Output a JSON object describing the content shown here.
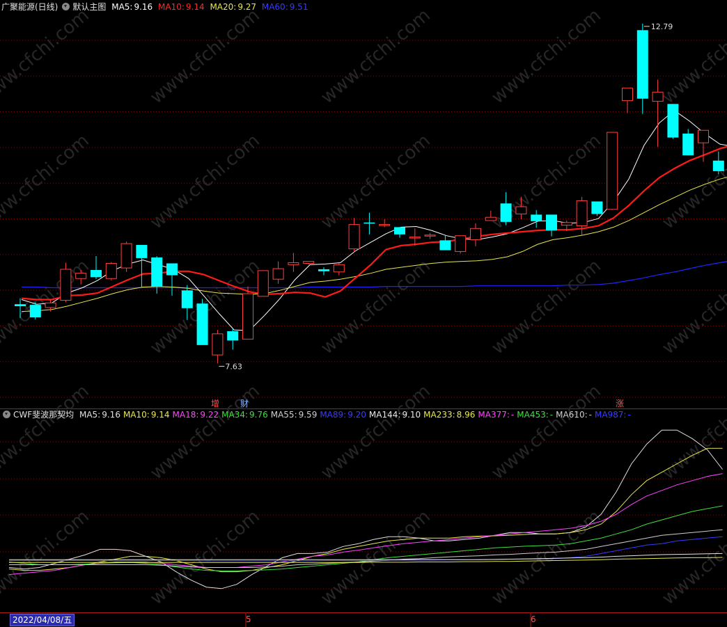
{
  "main_header": {
    "stock": "广聚能源(日线)",
    "indicator": "默认主图",
    "ma5_label": "MA5:",
    "ma5": "9.16",
    "ma10_label": "MA10:",
    "ma10": "9.14",
    "ma20_label": "MA20:",
    "ma20": "9.27",
    "ma60_label": "MA60:",
    "ma60": "9.51"
  },
  "sub_header": {
    "indicator": "CWF斐波那契均",
    "items": [
      {
        "label": "MA5:",
        "value": "9.16",
        "color": "#e0e0e0"
      },
      {
        "label": "MA10:",
        "value": "9.14",
        "color": "#e8e84a"
      },
      {
        "label": "MA18:",
        "value": "9.22",
        "color": "#ff44ff"
      },
      {
        "label": "MA34:",
        "value": "9.76",
        "color": "#3ee03e"
      },
      {
        "label": "MA55:",
        "value": "9.59",
        "color": "#cfcfcf"
      },
      {
        "label": "MA89:",
        "value": "9.20",
        "color": "#3a3aff"
      },
      {
        "label": "MA144:",
        "value": "9.10",
        "color": "#e8e8e8"
      },
      {
        "label": "MA233:",
        "value": "8.96",
        "color": "#e8e84a"
      },
      {
        "label": "MA377:",
        "value": "-",
        "color": "#ff44ff"
      },
      {
        "label": "MA453:",
        "value": "-",
        "color": "#3ee03e"
      },
      {
        "label": "MA610:",
        "value": "-",
        "color": "#cfcfcf"
      },
      {
        "label": "MA987:",
        "value": "-",
        "color": "#3a3aff"
      }
    ]
  },
  "annotations": {
    "high": "12.79",
    "low": "7.63",
    "tag_zeng": "增",
    "tag_cai": "财",
    "tag_zhang": "涨"
  },
  "x_axis": {
    "date": "2022/04/08/五",
    "tick_5": "5",
    "tick_6": "6"
  },
  "watermark": "www.cfchi.com",
  "colors": {
    "up": "#ff4040",
    "down": "#00ffff",
    "ma5": "#ffffff",
    "ma10": "#ff1a1a",
    "ma20": "#e8e84a",
    "ma60": "#2323ff",
    "grid": "#7a1010"
  },
  "chart_data": {
    "type": "candlestick",
    "ylim_main": [
      7.0,
      13.0
    ],
    "candles": [
      {
        "o": 8.53,
        "c": 8.5,
        "h": 8.62,
        "l": 8.32
      },
      {
        "o": 8.52,
        "c": 8.33,
        "h": 8.56,
        "l": 8.3
      },
      {
        "o": 8.48,
        "c": 8.55,
        "h": 8.6,
        "l": 8.42
      },
      {
        "o": 8.59,
        "c": 9.06,
        "h": 9.16,
        "l": 8.56
      },
      {
        "o": 8.92,
        "c": 9.0,
        "h": 9.05,
        "l": 8.83
      },
      {
        "o": 9.05,
        "c": 8.94,
        "h": 9.26,
        "l": 8.91
      },
      {
        "o": 8.92,
        "c": 9.15,
        "h": 9.17,
        "l": 8.89
      },
      {
        "o": 9.08,
        "c": 9.45,
        "h": 9.48,
        "l": 9.02
      },
      {
        "o": 9.43,
        "c": 9.23,
        "h": 9.43,
        "l": 8.78
      },
      {
        "o": 9.24,
        "c": 8.8,
        "h": 9.26,
        "l": 8.69
      },
      {
        "o": 9.15,
        "c": 8.97,
        "h": 9.15,
        "l": 8.66
      },
      {
        "o": 8.74,
        "c": 8.47,
        "h": 8.82,
        "l": 8.29
      },
      {
        "o": 8.54,
        "c": 7.91,
        "h": 8.61,
        "l": 7.91
      },
      {
        "o": 7.76,
        "c": 8.08,
        "h": 8.14,
        "l": 7.63
      },
      {
        "o": 8.12,
        "c": 7.98,
        "h": 8.16,
        "l": 7.84
      },
      {
        "o": 8.0,
        "c": 8.69,
        "h": 8.8,
        "l": 8.0
      },
      {
        "o": 8.65,
        "c": 9.04,
        "h": 9.04,
        "l": 8.65
      },
      {
        "o": 8.91,
        "c": 9.07,
        "h": 9.18,
        "l": 8.84
      },
      {
        "o": 9.13,
        "c": 9.16,
        "h": 9.31,
        "l": 9.02
      },
      {
        "o": 9.15,
        "c": 9.18,
        "h": 9.18,
        "l": 9.13
      },
      {
        "o": 9.06,
        "c": 9.03,
        "h": 9.09,
        "l": 8.97
      },
      {
        "o": 9.02,
        "c": 9.13,
        "h": 9.15,
        "l": 8.97
      },
      {
        "o": 9.37,
        "c": 9.74,
        "h": 9.84,
        "l": 9.32
      },
      {
        "o": 9.77,
        "c": 9.76,
        "h": 9.92,
        "l": 9.59
      },
      {
        "o": 9.74,
        "c": 9.74,
        "h": 9.82,
        "l": 9.7
      },
      {
        "o": 9.7,
        "c": 9.59,
        "h": 9.7,
        "l": 9.54
      },
      {
        "o": 9.54,
        "c": 9.55,
        "h": 9.68,
        "l": 9.42
      },
      {
        "o": 9.58,
        "c": 9.58,
        "h": 9.61,
        "l": 9.52
      },
      {
        "o": 9.5,
        "c": 9.35,
        "h": 9.58,
        "l": 9.35
      },
      {
        "o": 9.33,
        "c": 9.57,
        "h": 9.57,
        "l": 9.3
      },
      {
        "o": 9.51,
        "c": 9.68,
        "h": 9.76,
        "l": 9.41
      },
      {
        "o": 9.8,
        "c": 9.85,
        "h": 9.95,
        "l": 9.8
      },
      {
        "o": 10.06,
        "c": 9.78,
        "h": 10.23,
        "l": 9.73
      },
      {
        "o": 9.9,
        "c": 10.01,
        "h": 10.16,
        "l": 9.82
      },
      {
        "o": 9.89,
        "c": 9.79,
        "h": 9.96,
        "l": 9.69
      },
      {
        "o": 9.89,
        "c": 9.65,
        "h": 9.89,
        "l": 9.56
      },
      {
        "o": 9.73,
        "c": 9.77,
        "h": 9.8,
        "l": 9.64
      },
      {
        "o": 9.72,
        "c": 10.1,
        "h": 10.16,
        "l": 9.58
      },
      {
        "o": 10.09,
        "c": 9.9,
        "h": 10.09,
        "l": 9.87
      },
      {
        "o": 9.97,
        "c": 11.14,
        "h": 11.14,
        "l": 9.96
      },
      {
        "o": 11.62,
        "c": 11.81,
        "h": 11.81,
        "l": 11.43
      },
      {
        "o": 12.69,
        "c": 11.65,
        "h": 12.79,
        "l": 11.42
      },
      {
        "o": 11.61,
        "c": 11.75,
        "h": 11.94,
        "l": 10.92
      },
      {
        "o": 11.57,
        "c": 11.06,
        "h": 11.57,
        "l": 11.04
      },
      {
        "o": 11.12,
        "c": 10.79,
        "h": 11.19,
        "l": 10.79
      },
      {
        "o": 10.98,
        "c": 11.17,
        "h": 11.17,
        "l": 10.69
      },
      {
        "o": 10.71,
        "c": 10.55,
        "h": 10.85,
        "l": 10.5
      },
      {
        "o": 10.43,
        "c": 10.3,
        "h": 10.51,
        "l": 10.14
      }
    ],
    "ma5": [
      8.6,
      8.53,
      8.55,
      8.7,
      8.78,
      8.89,
      9.04,
      9.14,
      9.2,
      9.13,
      9.06,
      8.92,
      8.66,
      8.39,
      8.14,
      8.13,
      8.36,
      8.61,
      8.9,
      9.13,
      9.14,
      9.16,
      9.34,
      9.47,
      9.6,
      9.7,
      9.71,
      9.65,
      9.57,
      9.52,
      9.51,
      9.55,
      9.6,
      9.69,
      9.79,
      9.8,
      9.76,
      9.77,
      9.83,
      10.09,
      10.43,
      10.94,
      11.28,
      11.47,
      11.31,
      11.12,
      10.96,
      10.92
    ],
    "ma10": [
      8.62,
      8.6,
      8.6,
      8.66,
      8.67,
      8.7,
      8.8,
      8.9,
      8.99,
      9.0,
      9.03,
      9.03,
      8.98,
      8.89,
      8.8,
      8.72,
      8.68,
      8.69,
      8.71,
      8.7,
      8.64,
      8.73,
      8.93,
      9.13,
      9.36,
      9.42,
      9.44,
      9.47,
      9.48,
      9.52,
      9.56,
      9.59,
      9.61,
      9.63,
      9.65,
      9.66,
      9.66,
      9.68,
      9.72,
      9.84,
      10.03,
      10.25,
      10.45,
      10.59,
      10.71,
      10.8,
      10.89,
      10.96
    ],
    "ma20": [
      8.42,
      8.43,
      8.45,
      8.5,
      8.56,
      8.62,
      8.69,
      8.75,
      8.79,
      8.8,
      8.79,
      8.77,
      8.73,
      8.7,
      8.69,
      8.68,
      8.69,
      8.74,
      8.8,
      8.86,
      8.88,
      8.91,
      8.95,
      9.0,
      9.06,
      9.09,
      9.12,
      9.15,
      9.17,
      9.18,
      9.19,
      9.21,
      9.25,
      9.33,
      9.44,
      9.51,
      9.54,
      9.58,
      9.63,
      9.7,
      9.8,
      9.92,
      10.04,
      10.15,
      10.26,
      10.35,
      10.43,
      10.49
    ],
    "ma60": [
      8.79,
      8.79,
      8.78,
      8.78,
      8.78,
      8.78,
      8.78,
      8.78,
      8.78,
      8.78,
      8.78,
      8.78,
      8.78,
      8.78,
      8.78,
      8.78,
      8.78,
      8.78,
      8.78,
      8.79,
      8.79,
      8.79,
      8.79,
      8.79,
      8.8,
      8.8,
      8.8,
      8.8,
      8.8,
      8.8,
      8.81,
      8.81,
      8.81,
      8.81,
      8.81,
      8.81,
      8.82,
      8.82,
      8.83,
      8.85,
      8.89,
      8.93,
      8.98,
      9.02,
      9.07,
      9.12,
      9.16,
      9.2
    ],
    "sub_ylim": [
      7.0,
      14.0
    ],
    "sub_series": [
      {
        "key": "ma5",
        "color": "#e0e0e0",
        "values": [
          8.6,
          8.55,
          8.6,
          8.75,
          8.9,
          9.05,
          9.25,
          9.25,
          9.2,
          9.0,
          8.8,
          8.45,
          8.15,
          7.9,
          7.85,
          8.0,
          8.35,
          8.65,
          8.95,
          9.1,
          9.1,
          9.15,
          9.35,
          9.45,
          9.6,
          9.7,
          9.7,
          9.65,
          9.55,
          9.55,
          9.6,
          9.65,
          9.75,
          9.85,
          9.85,
          9.8,
          9.8,
          9.85,
          10.05,
          10.5,
          11.3,
          12.3,
          13.0,
          13.5,
          13.5,
          13.2,
          12.8,
          12.1
        ]
      },
      {
        "key": "ma10",
        "color": "#e8e84a",
        "values": [
          8.55,
          8.5,
          8.5,
          8.55,
          8.6,
          8.7,
          8.8,
          8.9,
          9.0,
          9.0,
          8.95,
          8.85,
          8.7,
          8.55,
          8.45,
          8.45,
          8.5,
          8.6,
          8.7,
          8.85,
          9.0,
          9.1,
          9.25,
          9.35,
          9.45,
          9.55,
          9.6,
          9.65,
          9.65,
          9.65,
          9.7,
          9.72,
          9.73,
          9.75,
          9.78,
          9.8,
          9.8,
          9.85,
          9.95,
          10.15,
          10.6,
          11.2,
          11.7,
          12.0,
          12.3,
          12.6,
          12.85,
          12.85
        ]
      },
      {
        "key": "ma18",
        "color": "#ff44ff",
        "values": [
          8.35,
          8.4,
          8.45,
          8.5,
          8.6,
          8.7,
          8.75,
          8.8,
          8.8,
          8.8,
          8.75,
          8.7,
          8.65,
          8.6,
          8.6,
          8.6,
          8.65,
          8.7,
          8.8,
          8.9,
          9.0,
          9.05,
          9.15,
          9.22,
          9.3,
          9.38,
          9.45,
          9.5,
          9.55,
          9.6,
          9.65,
          9.7,
          9.75,
          9.8,
          9.85,
          9.9,
          9.95,
          10.0,
          10.1,
          10.25,
          10.5,
          10.85,
          11.15,
          11.35,
          11.55,
          11.7,
          11.85,
          11.95
        ]
      },
      {
        "key": "ma34",
        "color": "#3ee03e",
        "values": [
          8.8,
          8.75,
          8.7,
          8.7,
          8.7,
          8.72,
          8.75,
          8.77,
          8.78,
          8.75,
          8.7,
          8.62,
          8.55,
          8.5,
          8.48,
          8.48,
          8.5,
          8.52,
          8.55,
          8.6,
          8.65,
          8.7,
          8.75,
          8.8,
          8.88,
          8.95,
          9.0,
          9.05,
          9.1,
          9.15,
          9.2,
          9.25,
          9.3,
          9.33,
          9.36,
          9.38,
          9.4,
          9.45,
          9.55,
          9.65,
          9.8,
          9.95,
          10.15,
          10.3,
          10.45,
          10.6,
          10.7,
          10.8
        ]
      },
      {
        "key": "ma55",
        "color": "#cfcfcf",
        "values": [
          8.7,
          8.7,
          8.7,
          8.7,
          8.7,
          8.7,
          8.7,
          8.7,
          8.7,
          8.7,
          8.68,
          8.65,
          8.62,
          8.6,
          8.6,
          8.6,
          8.6,
          8.62,
          8.65,
          8.7,
          8.72,
          8.75,
          8.78,
          8.8,
          8.83,
          8.86,
          8.9,
          8.92,
          8.95,
          8.98,
          9.0,
          9.02,
          9.05,
          9.07,
          9.1,
          9.13,
          9.15,
          9.2,
          9.25,
          9.35,
          9.45,
          9.55,
          9.65,
          9.75,
          9.8,
          9.85,
          9.9,
          9.95
        ]
      },
      {
        "key": "ma89",
        "color": "#3a3aff",
        "values": [
          8.85,
          8.85,
          8.85,
          8.85,
          8.85,
          8.85,
          8.85,
          8.85,
          8.85,
          8.85,
          8.85,
          8.85,
          8.85,
          8.84,
          8.84,
          8.84,
          8.84,
          8.84,
          8.84,
          8.84,
          8.84,
          8.85,
          8.85,
          8.85,
          8.85,
          8.86,
          8.86,
          8.87,
          8.87,
          8.88,
          8.88,
          8.89,
          8.89,
          8.9,
          8.9,
          8.9,
          8.92,
          8.95,
          9.0,
          9.1,
          9.2,
          9.3,
          9.4,
          9.45,
          9.55,
          9.6,
          9.65,
          9.7
        ]
      },
      {
        "key": "ma144",
        "color": "#e8e8e8",
        "values": [
          8.88,
          8.88,
          8.88,
          8.88,
          8.88,
          8.88,
          8.88,
          8.88,
          8.88,
          8.88,
          8.88,
          8.88,
          8.88,
          8.88,
          8.88,
          8.88,
          8.88,
          8.88,
          8.88,
          8.88,
          8.88,
          8.88,
          8.88,
          8.88,
          8.88,
          8.88,
          8.88,
          8.88,
          8.88,
          8.88,
          8.88,
          8.88,
          8.89,
          8.9,
          8.91,
          8.92,
          8.93,
          8.94,
          8.95,
          8.97,
          9.0,
          9.02,
          9.04,
          9.06,
          9.07,
          9.08,
          9.09,
          9.1
        ]
      },
      {
        "key": "ma233",
        "color": "#e8e84a",
        "values": [
          8.78,
          8.78,
          8.78,
          8.78,
          8.78,
          8.78,
          8.78,
          8.78,
          8.78,
          8.78,
          8.78,
          8.78,
          8.78,
          8.78,
          8.78,
          8.78,
          8.78,
          8.78,
          8.78,
          8.78,
          8.78,
          8.78,
          8.78,
          8.78,
          8.79,
          8.79,
          8.79,
          8.8,
          8.8,
          8.8,
          8.81,
          8.81,
          8.82,
          8.82,
          8.83,
          8.84,
          8.85,
          8.86,
          8.87,
          8.88,
          8.9,
          8.91,
          8.92,
          8.93,
          8.94,
          8.95,
          8.95,
          8.96
        ]
      }
    ]
  }
}
